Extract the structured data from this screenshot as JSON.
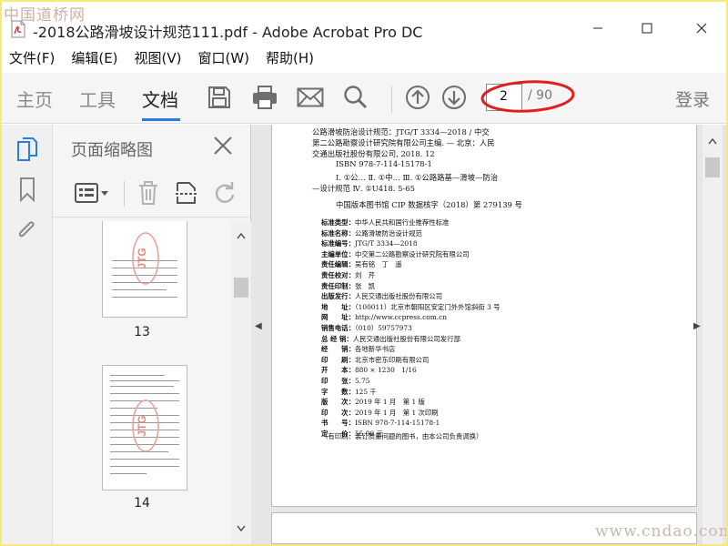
{
  "watermark": {
    "site": "中国道桥网",
    "url": "www.cndao.com"
  },
  "window": {
    "title": "-2018公路滑坡设计规范111.pdf - Adobe Acrobat Pro DC",
    "app_icon": "pdf-icon",
    "controls": [
      "minimize-icon",
      "maximize-icon",
      "close-icon"
    ]
  },
  "menu": {
    "items": [
      {
        "label": "文件(F)"
      },
      {
        "label": "编辑(E)"
      },
      {
        "label": "视图(V)"
      },
      {
        "label": "窗口(W)"
      },
      {
        "label": "帮助(H)"
      }
    ]
  },
  "toolbar": {
    "tabs": [
      {
        "label": "主页",
        "active": false
      },
      {
        "label": "工具",
        "active": false
      },
      {
        "label": "文档",
        "active": true
      }
    ],
    "icons": [
      "save-icon",
      "print-icon",
      "mail-icon",
      "search-icon",
      "arrow-up-icon",
      "arrow-down-icon"
    ],
    "page_current": "2",
    "page_total": "/ 90",
    "login": "登录",
    "accent_color": "#2b7be4",
    "annotation_color": "#e02020"
  },
  "rail": {
    "icons": [
      "page-thumbnails-icon",
      "bookmark-icon",
      "attachment-icon"
    ]
  },
  "thumbnails_panel": {
    "title": "页面缩略图",
    "tools": [
      "options-icon",
      "delete-icon",
      "extract-icon",
      "rotate-icon"
    ],
    "pages": [
      {
        "number": "13",
        "stamp": "JTG"
      },
      {
        "number": "14",
        "stamp": "JTG"
      }
    ]
  },
  "document": {
    "cip_lines": [
      "公路滑坡防治设计规范：JTG/T 3334—2018 / 中交",
      "第二公路勘察设计研究院有限公司主编. — 北京：人民",
      "交通出版社股份有限公司, 2018. 12",
      "ISBN 978-7-114-15178-1",
      "Ⅰ. ①公… Ⅱ. ①中… Ⅲ. ①公路路基—滑坡—防治",
      "—设计规范  Ⅳ. ①U418. 5-65",
      "中国版本图书馆 CIP 数据核字（2018）第 279139 号"
    ],
    "details": [
      {
        "label": "标准类型：",
        "value": "中华人民共和国行业推荐性标准"
      },
      {
        "label": "标准名称：",
        "value": "公路滑坡防治设计规范"
      },
      {
        "label": "标准编号：",
        "value": "JTG/T 3334—2018"
      },
      {
        "label": "主编单位：",
        "value": "中交第二公路勘察设计研究院有限公司"
      },
      {
        "label": "责任编辑：",
        "value": "吴有铭　丁　遥"
      },
      {
        "label": "责任校对：",
        "value": "刘　芹"
      },
      {
        "label": "责任印制：",
        "value": "张　凯"
      },
      {
        "label": "出版发行：",
        "value": "人民交通出版社股份有限公司"
      },
      {
        "label": "地　　址：",
        "value": "（100011）北京市朝阳区安定门外外馆斜街 3 号"
      },
      {
        "label": "网　　址：",
        "value": "http://www.ccpress.com.cn"
      },
      {
        "label": "销售电话：",
        "value": "（010）59757973"
      },
      {
        "label": "总 经 销：",
        "value": "人民交通出版社股份有限公司发行部"
      },
      {
        "label": "经　　销：",
        "value": "各地新华书店"
      },
      {
        "label": "印　　刷：",
        "value": "北京市密东印刷有限公司"
      },
      {
        "label": "开　　本：",
        "value": "880 × 1230　1/16"
      },
      {
        "label": "印　　张：",
        "value": "5.75"
      },
      {
        "label": "字　　数：",
        "value": "125 千"
      },
      {
        "label": "版　　次：",
        "value": "2019 年 1 月　第 1 版"
      },
      {
        "label": "印　　次：",
        "value": "2019 年 1 月　第 1 次印刷"
      },
      {
        "label": "书　　号：",
        "value": "ISBN 978-7-114-15178-1"
      },
      {
        "label": "定　　价：",
        "value": "55.00 元"
      }
    ],
    "footer_note": "（有印刷、装订质量问题的图书，由本公司负责调换）"
  }
}
